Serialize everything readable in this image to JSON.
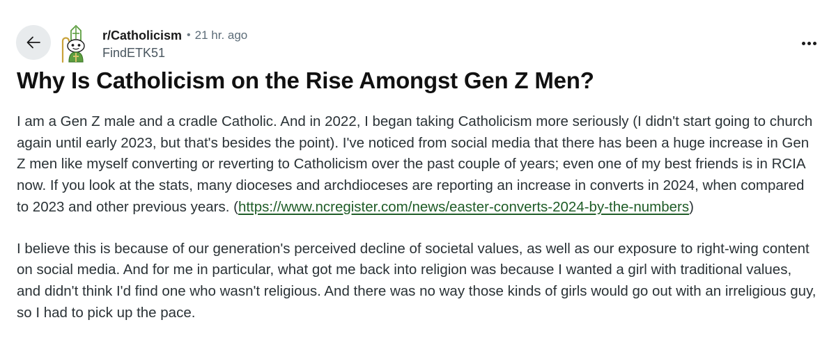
{
  "post": {
    "subreddit": "r/Catholicism",
    "separator": "•",
    "timestamp": "21 hr. ago",
    "author": "FindETK51",
    "title": "Why Is Catholicism on the Rise Amongst Gen Z Men?",
    "paragraph1_text": "I am a Gen Z male and a cradle Catholic. And in 2022, I began taking Catholicism more seriously (I didn't start going to church again until early 2023, but that's besides the point). I've noticed from social media that there has been a huge increase in Gen Z men like myself converting or reverting to Catholicism over the past couple of years; even one of my best friends is in RCIA now. If you look at the stats, many dioceses and archdioceses are reporting an increase in converts in 2024, when compared to 2023 and other previous years. (",
    "paragraph1_link": "https://www.ncregister.com/news/easter-converts-2024-by-the-numbers",
    "paragraph1_close": ")",
    "paragraph2": "I believe this is because of our generation's perceived decline of societal values, as well as our exposure to right-wing content on social media. And for me in particular, what got me back into religion was because I wanted a girl with traditional values, and didn't think I'd find one who wasn't religious. And there was no way those kinds of girls would go out with an irreligious guy, so I had to pick up the pace."
  },
  "icons": {
    "back": "arrow-left-icon",
    "avatar": "bishop-snoo-avatar",
    "more": "more-horizontal-icon"
  },
  "colors": {
    "link": "#1f5c27",
    "back_button_bg": "#e8ebed",
    "avatar_green": "#5c9e3f"
  }
}
